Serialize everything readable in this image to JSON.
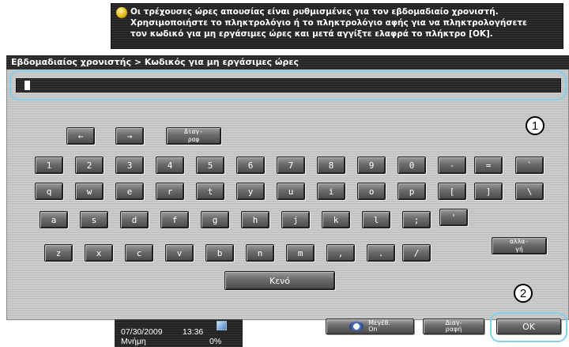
{
  "message": {
    "line1": "Οι τρέχουσες ώρες απουσίας είναι ρυθμισμένες για τον εβδομαδιαίο χρονιστή.",
    "line2": "Χρησιμοποιήστε το πληκτρολόγιο ή το πληκτρολόγιο αφής για να πληκτρολογήσετε",
    "line3": "τον κωδικό για μη εργάσιμες ώρες και μετά αγγίξτε ελαφρά το πλήκτρο [OK].",
    "icon": "info-bulb-icon"
  },
  "title": "Εβδομαδιαίος χρονιστής > Κωδικός για μη εργάσιμες ώρες",
  "input": {
    "value": ""
  },
  "callouts": {
    "one": "1",
    "two": "2"
  },
  "nav_keys": {
    "left": "←",
    "right": "→",
    "delete_l1": "Διαγ-",
    "delete_l2": "ραφ"
  },
  "rows": {
    "row1": [
      "1",
      "2",
      "3",
      "4",
      "5",
      "6",
      "7",
      "8",
      "9",
      "0",
      "-",
      "=",
      "`"
    ],
    "row2": [
      "q",
      "w",
      "e",
      "r",
      "t",
      "y",
      "u",
      "i",
      "o",
      "p",
      "[",
      "]",
      "\\"
    ],
    "row3": [
      "a",
      "s",
      "d",
      "f",
      "g",
      "h",
      "j",
      "k",
      "l",
      ";",
      "'"
    ],
    "row4": [
      "z",
      "x",
      "c",
      "v",
      "b",
      "n",
      "m",
      ",",
      ".",
      "/"
    ]
  },
  "change_key": {
    "l1": "αλλα-",
    "l2": "γή"
  },
  "space_label": "Κενό",
  "status": {
    "date": "07/30/2009",
    "time": "13:36",
    "memory_label": "Μνήμη",
    "memory_value": "0%"
  },
  "bottom_buttons": {
    "enlarge_l1": "Μεγέθ.",
    "enlarge_l2": "On",
    "delete_l1": "Διαγ-",
    "delete_l2": "ραφή",
    "ok": "OK"
  }
}
